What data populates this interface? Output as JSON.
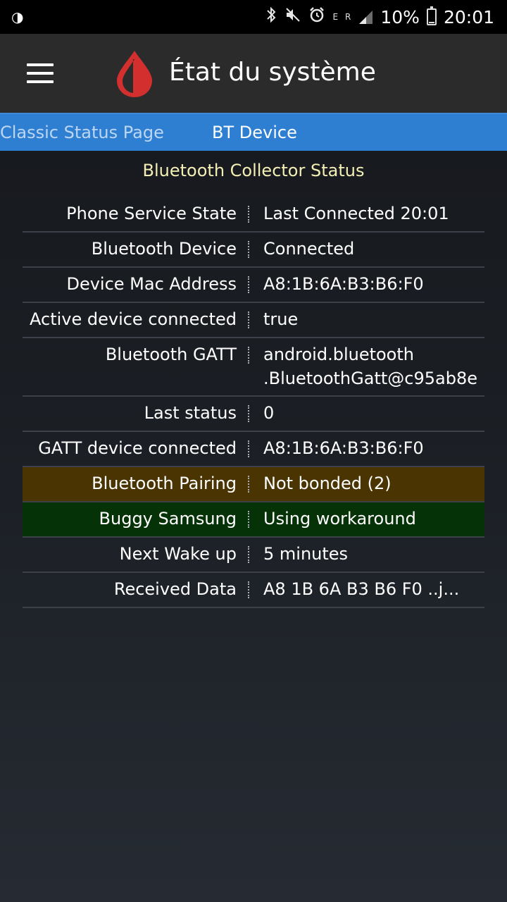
{
  "statusbar": {
    "left_icon": "brightness-half-icon",
    "bluetooth_icon": "✳",
    "battery_text": "10%",
    "time": "20:01",
    "net_e": "E",
    "net_r": "R"
  },
  "appbar": {
    "title": "État du système"
  },
  "tabs": [
    {
      "label": "Classic Status Page"
    },
    {
      "label": "BT Device"
    }
  ],
  "section_title": "Bluetooth Collector Status",
  "rows": [
    {
      "label": "Phone Service State",
      "value": "Last Connected 20:01"
    },
    {
      "label": "Bluetooth Device",
      "value": "Connected"
    },
    {
      "label": "Device Mac Address",
      "value": "A8:1B:6A:B3:B6:F0"
    },
    {
      "label": "Active device connected",
      "value": "true"
    },
    {
      "label": "Bluetooth GATT",
      "value_line1": "android.bluetooth",
      "value_line2": ".BluetoothGatt@c95ab8e"
    },
    {
      "label": "Last status",
      "value": "0"
    },
    {
      "label": "GATT device connected",
      "value": "A8:1B:6A:B3:B6:F0"
    },
    {
      "label": "Bluetooth Pairing",
      "value": "Not bonded (2)"
    },
    {
      "label": "Buggy Samsung",
      "value": "Using workaround"
    },
    {
      "label": "Next Wake up",
      "value": "5 minutes"
    },
    {
      "label": "Received Data",
      "value": "A8 1B 6A B3 B6 F0 ..j..."
    }
  ],
  "colors": {
    "tabbar": "#2e7fd1",
    "appbar": "#2b2b2b",
    "pairing_warning_bg": "#4a3401",
    "samsung_ok_bg": "#053206",
    "section_title": "#f3efb4",
    "logo_red": "#d32f2f"
  },
  "battery_level": 0.1
}
